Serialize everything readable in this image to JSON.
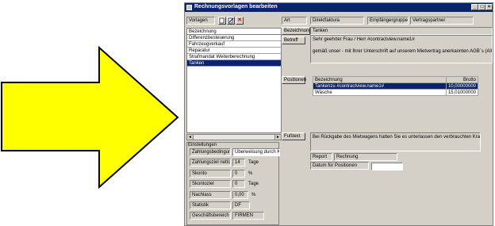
{
  "window": {
    "title": "Rechnungsvorlagen bearbeiten",
    "minimize": "_",
    "maximize": "□",
    "close": "×"
  },
  "left": {
    "vorlagen_label": "Vorlagen",
    "list_header": "Bezeichnung",
    "items": [
      "Differenzbesteuerung",
      "Fahrzeugverkauf",
      "Reparatur",
      "Strafmandat Weiterberechnung",
      "Tanken"
    ],
    "selected_index": 4,
    "scroll_left": "◄",
    "scroll_right": "►"
  },
  "settings": {
    "group_label": "Einstellungen",
    "zahlungsbedingung_label": "Zahlungsbedingung",
    "zahlungsbedingung_value": "Überweisung durch Kunden",
    "zahlungsziel_label": "Zahlungsziel netto",
    "zahlungsziel_value": "14",
    "zahlungsziel_unit": "Tage",
    "skonto_label": "Skonto",
    "skonto_value": "0",
    "skonto_unit": "%",
    "skontoziel_label": "Skontoziel",
    "skontoziel_value": "0",
    "skontoziel_unit": "Tage",
    "nachlass_label": "Nachlass",
    "nachlass_value": "0,00",
    "nachlass_unit": "%",
    "statistik_label": "Statistik",
    "statistik_value": "DF",
    "geschaeftsbereich_label": "Geschäftsbereich",
    "geschaeftsbereich_value": "FIRMEN"
  },
  "detail": {
    "art_label": "Art",
    "art_value": "Direktfaktura",
    "empfaengergruppe_label": "Empfängergruppe",
    "empfaengergruppe_value": "Vertragspartner",
    "bezeichnung_label": "Bezeichnung",
    "bezeichnung_value": "Tanken",
    "betreff_label": "Betreff",
    "betreff_line1": "Sehr geehrter Frau / Herr #contractview.name1#",
    "betreff_line2": "gemäß unser - mit Ihrer Unterschrift auf unserem Mietvertrag anerkannten AGB´s (Allge",
    "positionen_label": "Positionen",
    "positionen_columns": [
      "Bezeichnung",
      "Brutto"
    ],
    "positionen_rows": [
      [
        "Tankenzu #contractview.name1#",
        "10,00000000"
      ],
      [
        "Wäsche",
        "15,01000000"
      ]
    ],
    "fusstext_label": "Fußtext",
    "fusstext_value": "Bei Rückgabe des Mietwagens hatten Sie es unterlassen den verbrauchten Kraftstoff",
    "report_label": "Report",
    "report_value": "Rechnung",
    "datum_label": "Datum für Positionen",
    "datum_value": ""
  }
}
